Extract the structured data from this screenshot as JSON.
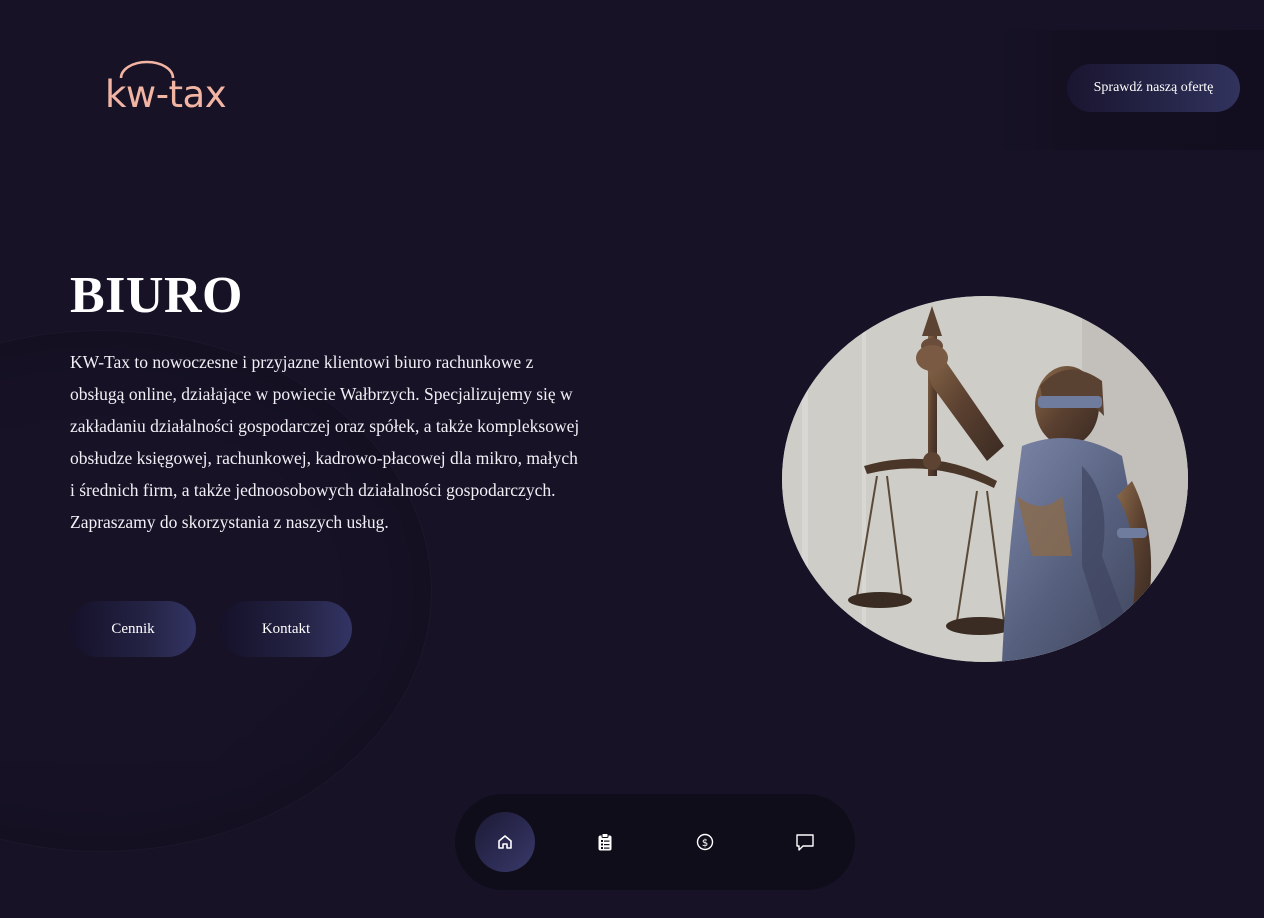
{
  "header": {
    "logo_text": "kw-tax",
    "offer_button_label": "Sprawdź naszą ofertę"
  },
  "hero": {
    "title": "BIURO",
    "description": "KW-Tax to nowoczesne i przyjazne klientowi biuro rachunkowe z obsługą online, działające w powiecie Wałbrzych. Specjalizujemy się w zakładaniu działalności gospodarczej oraz spółek, a także kompleksowej obsłudze księgowej, rachunkowej, kadrowo-płacowej dla mikro, małych i średnich firm, a także jednoosobowych działalności gospodarczych. Zapraszamy do skorzystania z naszych usług.",
    "buttons": {
      "pricing": "Cennik",
      "contact": "Kontakt"
    }
  },
  "bottom_nav": {
    "items": [
      {
        "icon": "home-icon",
        "active": true
      },
      {
        "icon": "clipboard-list-icon",
        "active": false
      },
      {
        "icon": "dollar-coin-icon",
        "active": false
      },
      {
        "icon": "chat-bubble-icon",
        "active": false
      }
    ]
  },
  "colors": {
    "background": "#171226",
    "logo_accent": "#f2b5a4",
    "button_gradient_end": "#333464",
    "nav_background": "#100d1b"
  }
}
